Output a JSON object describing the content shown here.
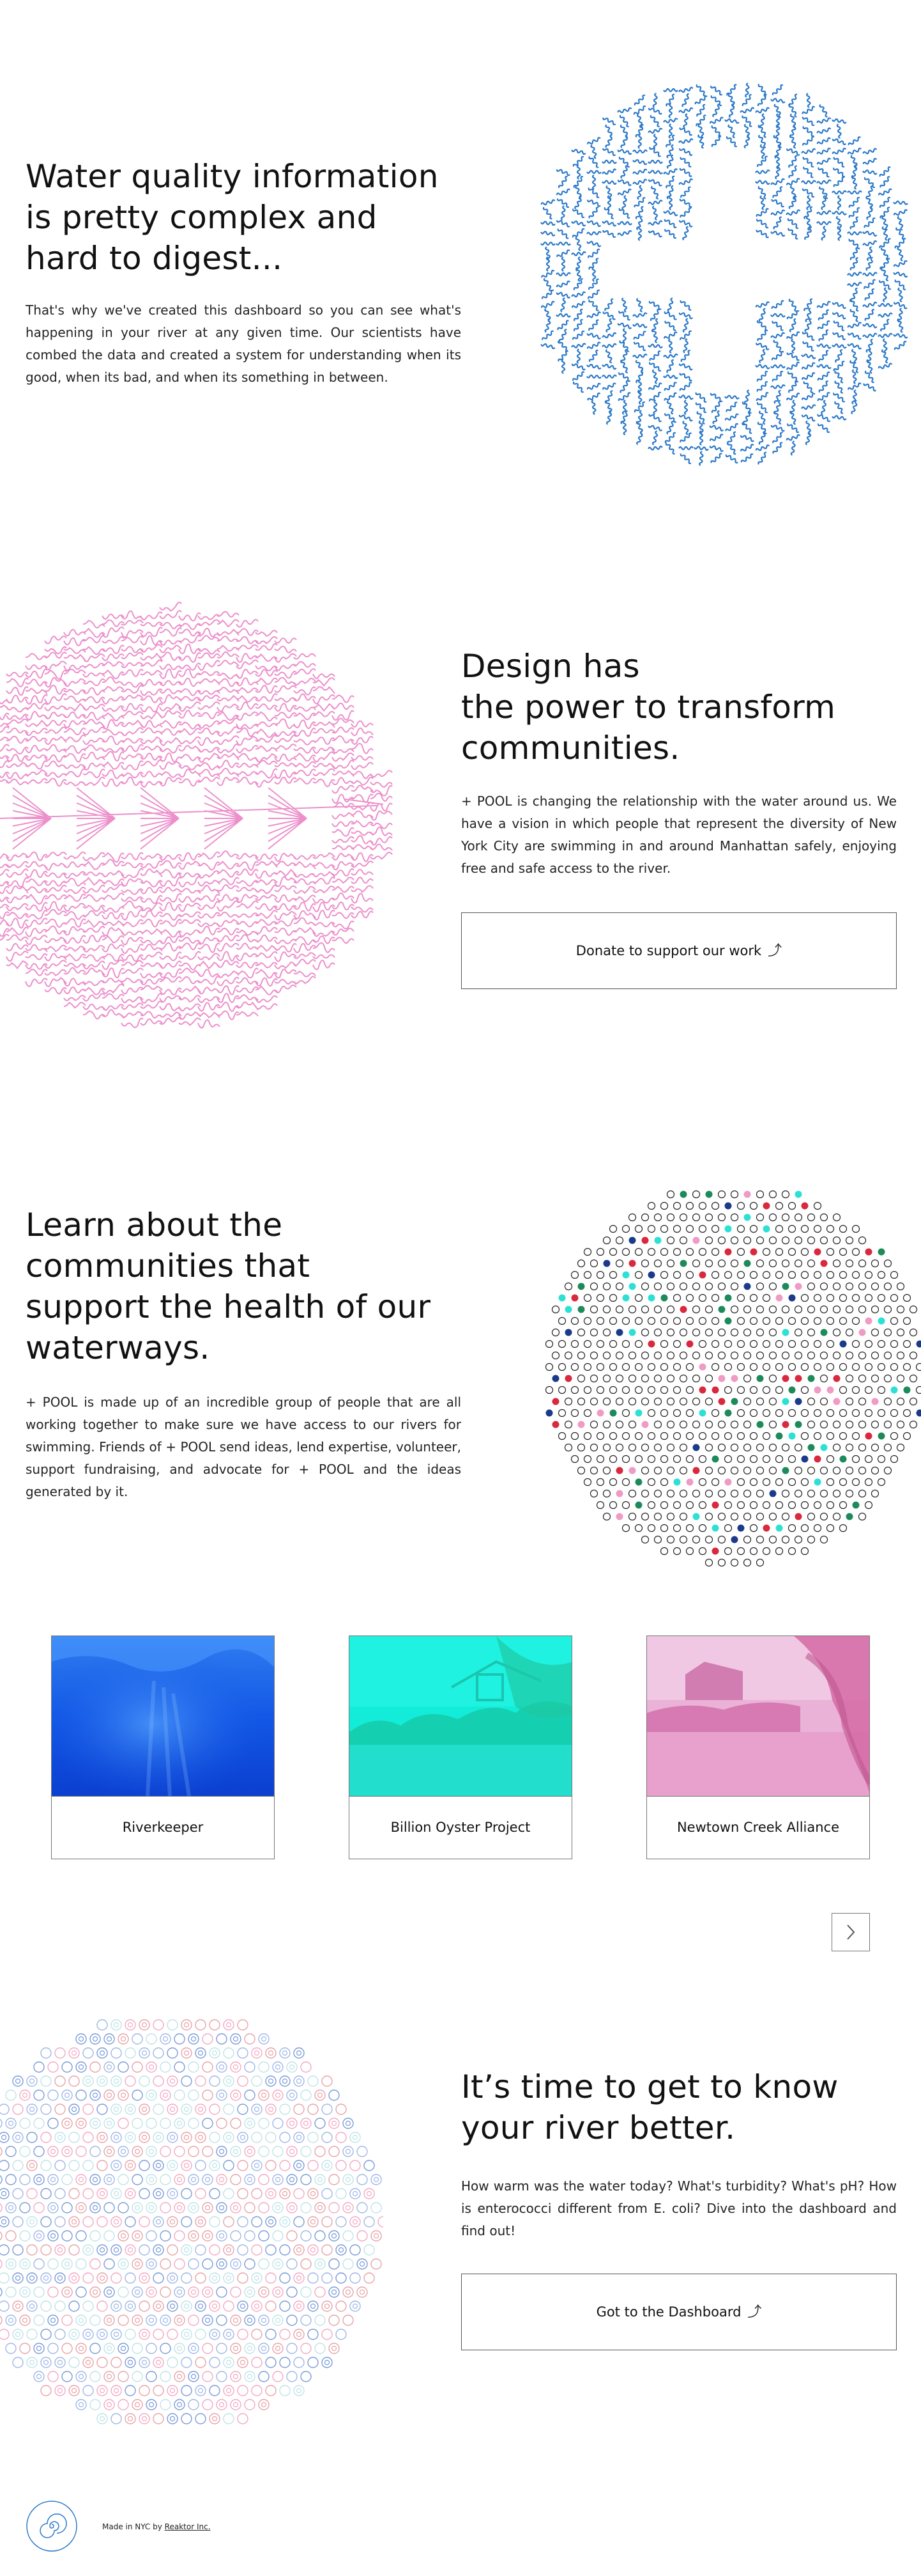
{
  "section_water": {
    "title": "Water quality information\nis pretty complex and\nhard to digest...",
    "body": "That's why we've created this dashboard so you can see what's happening in your river at any given time.  Our scientists have combed the data and created a system for understanding when its good, when its bad, and when its something in between.",
    "art_color": "#2a78c8",
    "art_icon": "squiggle-circle-plus"
  },
  "section_design": {
    "title": "Design has\nthe power to transform\ncommunities.",
    "body": "+ POOL is changing the relationship with the water around us. We have a vision in which people that represent the diversity of New York City are swimming in and around Manhattan safely, enjoying free and safe access to the river.",
    "button_label": "Donate to support our work",
    "art_color": "#ec8fcb",
    "art_icon": "squiggle-circle-chevrons"
  },
  "section_communities": {
    "title": "Learn about the\ncommunities that\nsupport the health of our\nwaterways.",
    "body": "+ POOL is made up of an incredible group of people that are all working together to make sure we have access to our rivers for swimming. Friends of + POOL send ideas, lend expertise, volunteer, support fundraising, and advocate for + POOL and the ideas generated by it.",
    "dot_colors": [
      "#1b3a8a",
      "#2de0d6",
      "#f09ac6",
      "#d8293e",
      "#1e8a5a"
    ],
    "cards": [
      {
        "label": "Riverkeeper",
        "tint": "#1a5fe0"
      },
      {
        "label": "Billion Oyster Project",
        "tint": "#11e8d4"
      },
      {
        "label": "Newtown Creek Alliance",
        "tint": "#e58fc4"
      }
    ],
    "next_icon": "chevron-right-icon"
  },
  "section_dashboard": {
    "title": "It’s time to get to know\nyour river better.",
    "body": "How warm was the water today? What's turbidity? What's pH? How is enterococci different from E. coli? Dive into the dashboard and find out!",
    "button_label": "Got to the Dashboard",
    "ring_colors": [
      "#9fb7e6",
      "#f2a9c4",
      "#bfe3e8",
      "#e7a3a8",
      "#7a9bd8"
    ]
  },
  "footer": {
    "made_in": "Made in NYC by",
    "studio": "Reaktor Inc.",
    "logo_icon": "spiral-logo-icon"
  }
}
